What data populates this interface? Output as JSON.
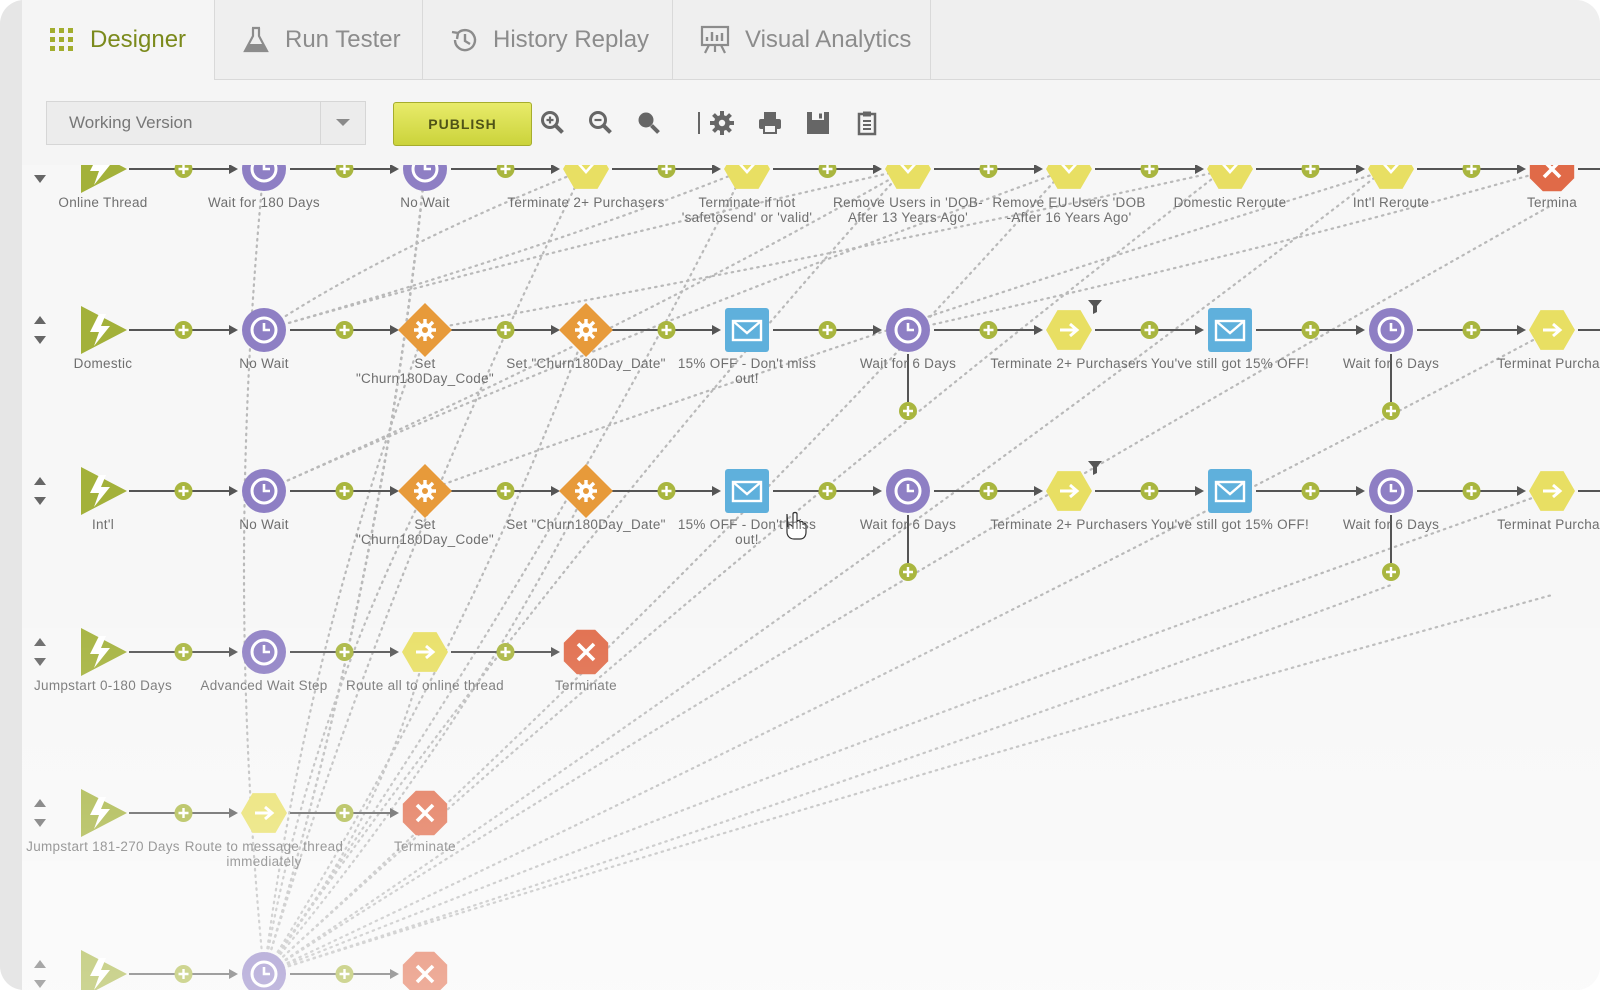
{
  "tabs": [
    {
      "label": "Designer",
      "icon": "grid-icon",
      "active": true
    },
    {
      "label": "Run Tester",
      "icon": "flask-icon",
      "active": false
    },
    {
      "label": "History Replay",
      "icon": "history-icon",
      "active": false
    },
    {
      "label": "Visual Analytics",
      "icon": "analytics-board-icon",
      "active": false
    }
  ],
  "toolbar": {
    "version_value": "Working Version",
    "publish_label": "PUBLISH",
    "icons": [
      "zoom-in-icon",
      "zoom-out-icon",
      "zoom-reset-icon",
      "settings-icon",
      "print-icon",
      "save-icon",
      "clipboard-icon"
    ]
  },
  "colors": {
    "accent": "#7b8a1c",
    "trigger": "#a3b13a",
    "wait": "#8e7fc4",
    "set_field": "#e79a3a",
    "message": "#5fb0dc",
    "split": "#e8df63",
    "terminate": "#e06a48",
    "connector_plus": "#a9b63f"
  },
  "rows": [
    {
      "steps": [
        {
          "type": "trigger",
          "label": "Online Thread"
        },
        {
          "type": "wait",
          "label": "Wait for 180 Days"
        },
        {
          "type": "wait",
          "label": "No Wait"
        },
        {
          "type": "split",
          "label": "Terminate 2+ Purchasers"
        },
        {
          "type": "split",
          "label": "Terminate if not 'safetosend' or 'valid'"
        },
        {
          "type": "split",
          "label": "Remove Users in 'DOB-After 13 Years Ago'"
        },
        {
          "type": "split",
          "label": "Remove EU Users 'DOB -After 16 Years Ago'"
        },
        {
          "type": "split",
          "label": "Domestic Reroute"
        },
        {
          "type": "split",
          "label": "Int'l Reroute"
        },
        {
          "type": "terminate",
          "label": "Termina"
        }
      ]
    },
    {
      "steps": [
        {
          "type": "trigger",
          "label": "Domestic"
        },
        {
          "type": "wait",
          "label": "No Wait"
        },
        {
          "type": "set",
          "label": "Set \"Churn180Day_Code\""
        },
        {
          "type": "set",
          "label": "Set \"Churn180Day_Date\""
        },
        {
          "type": "message",
          "label": "15% OFF - Don't miss out!"
        },
        {
          "type": "wait",
          "label": "Wait for 6 Days",
          "branch": true
        },
        {
          "type": "route",
          "label": "Terminate 2+ Purchasers",
          "filter": true
        },
        {
          "type": "message",
          "label": "You've still got 15% OFF!"
        },
        {
          "type": "wait",
          "label": "Wait for 6 Days",
          "branch": true
        },
        {
          "type": "route",
          "label": "Terminat Purchas"
        }
      ]
    },
    {
      "steps": [
        {
          "type": "trigger",
          "label": "Int'l"
        },
        {
          "type": "wait",
          "label": "No Wait"
        },
        {
          "type": "set",
          "label": "Set \"Churn180Day_Code\""
        },
        {
          "type": "set",
          "label": "Set \"Churn180Day_Date\""
        },
        {
          "type": "message",
          "label": "15% OFF - Don't miss out!"
        },
        {
          "type": "wait",
          "label": "Wait for 6 Days",
          "branch": true
        },
        {
          "type": "route",
          "label": "Terminate 2+ Purchasers",
          "filter": true
        },
        {
          "type": "message",
          "label": "You've still got 15% OFF!"
        },
        {
          "type": "wait",
          "label": "Wait for 6 Days",
          "branch": true
        },
        {
          "type": "route",
          "label": "Terminat Purchas"
        }
      ]
    },
    {
      "steps": [
        {
          "type": "trigger",
          "label": "Jumpstart 0-180 Days"
        },
        {
          "type": "wait",
          "label": "Advanced Wait Step"
        },
        {
          "type": "route",
          "label": "Route all to online thread"
        },
        {
          "type": "terminate",
          "label": "Terminate"
        }
      ]
    },
    {
      "steps": [
        {
          "type": "trigger",
          "label": "Jumpstart 181-270 Days"
        },
        {
          "type": "route",
          "label": "Route to message thread immediately"
        },
        {
          "type": "terminate",
          "label": "Terminate"
        }
      ]
    },
    {
      "steps": [
        {
          "type": "trigger",
          "label": ""
        },
        {
          "type": "wait",
          "label": ""
        },
        {
          "type": "terminate",
          "label": ""
        }
      ]
    }
  ]
}
